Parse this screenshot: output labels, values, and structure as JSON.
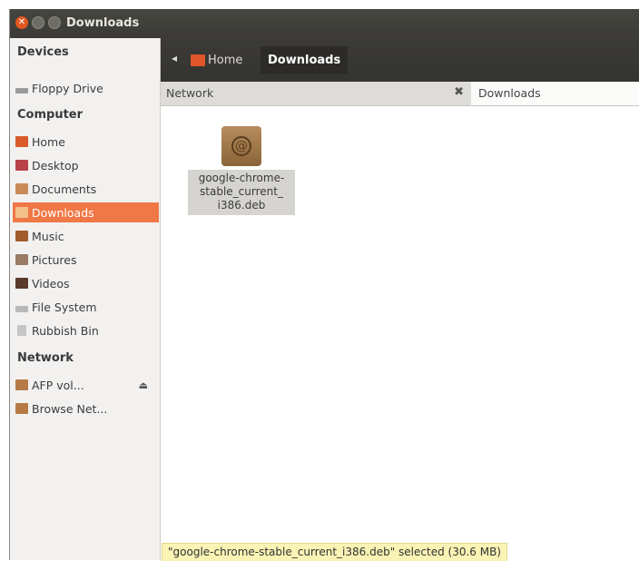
{
  "window": {
    "title": "Downloads"
  },
  "sidebar": {
    "devices_heading": "Devices",
    "devices": [
      {
        "label": "Floppy Drive",
        "icon": "floppy-drive-icon"
      }
    ],
    "computer_heading": "Computer",
    "computer": [
      {
        "label": "Home",
        "icon": "home-folder-icon"
      },
      {
        "label": "Desktop",
        "icon": "desktop-icon"
      },
      {
        "label": "Documents",
        "icon": "documents-icon"
      },
      {
        "label": "Downloads",
        "icon": "downloads-icon",
        "selected": true
      },
      {
        "label": "Music",
        "icon": "music-icon"
      },
      {
        "label": "Pictures",
        "icon": "pictures-icon"
      },
      {
        "label": "Videos",
        "icon": "videos-icon"
      },
      {
        "label": "File System",
        "icon": "drive-icon"
      },
      {
        "label": "Rubbish Bin",
        "icon": "trash-icon"
      }
    ],
    "network_heading": "Network",
    "network": [
      {
        "label": "AFP vol...",
        "icon": "network-share-icon",
        "eject": true
      },
      {
        "label": "Browse Net...",
        "icon": "network-icon"
      }
    ]
  },
  "toolbar": {
    "crumb_home": "Home",
    "crumb_current": "Downloads"
  },
  "tabs": [
    {
      "label": "Network",
      "closable": true
    },
    {
      "label": "Downloads"
    }
  ],
  "files": [
    {
      "name": "google-chrome-stable_current_i386.deb",
      "line1": "google-chrome-",
      "line2": "stable_current_",
      "line3": "i386.deb",
      "icon": "debian-package-icon"
    }
  ],
  "status": "\"google-chrome-stable_current_i386.deb\" selected (30.6 MB)",
  "colors": {
    "accent": "#f07746",
    "titlebar": "#3c3b37",
    "close": "#e25822"
  }
}
